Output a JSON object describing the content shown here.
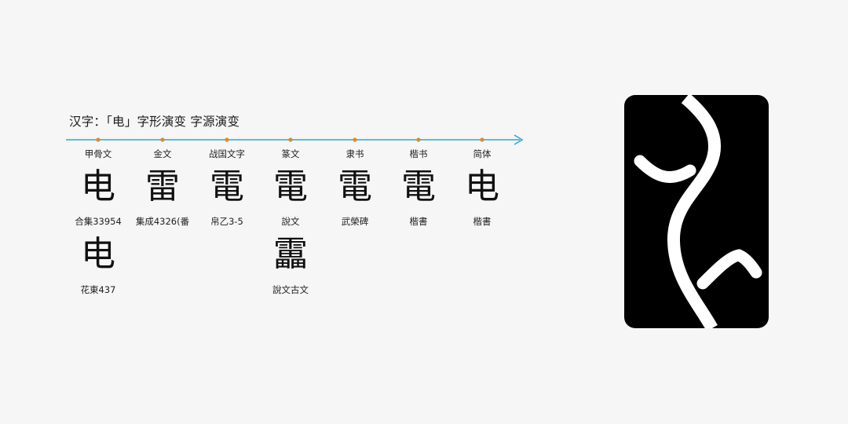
{
  "title": "汉字：「电」字形演变 字源演变",
  "colors": {
    "axis": "#2aa9d6",
    "tick": "#e08a2a",
    "emblem_bg": "#000000",
    "emblem_stroke": "#ffffff"
  },
  "stages": [
    {
      "era": "甲骨文",
      "glyph": "电",
      "source": "合集33954",
      "extra_glyph": "电",
      "extra_source": "花東437"
    },
    {
      "era": "金文",
      "glyph": "雷",
      "source": "集成4326(番"
    },
    {
      "era": "战国文字",
      "glyph": "電",
      "source": "帛乙3-5"
    },
    {
      "era": "篆文",
      "glyph": "電",
      "source": "說文",
      "extra_glyph": "靁",
      "extra_source": "說文古文"
    },
    {
      "era": "隶书",
      "glyph": "電",
      "source": "武榮碑"
    },
    {
      "era": "楷书",
      "glyph": "電",
      "source": "楷書"
    },
    {
      "era": "简体",
      "glyph": "电",
      "source": "楷書"
    }
  ],
  "emblem": {
    "icon": "lightning-emblem-icon"
  }
}
